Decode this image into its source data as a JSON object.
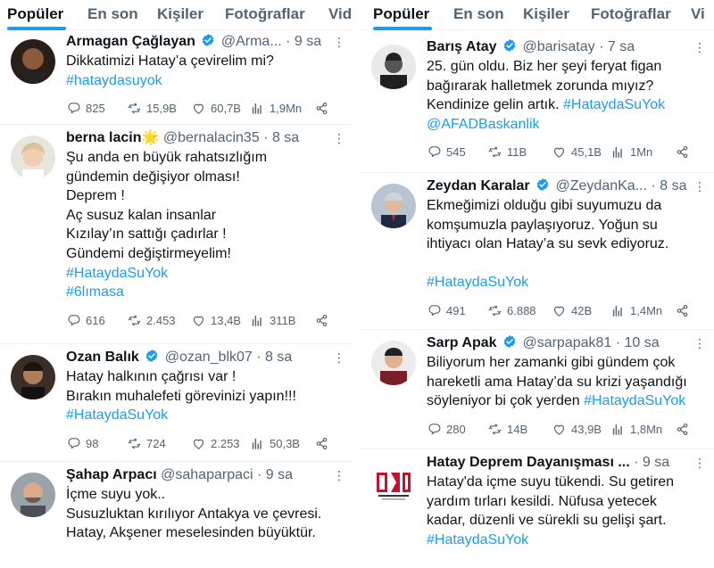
{
  "left": {
    "tabs": [
      "Popüler",
      "En son",
      "Kişiler",
      "Fotoğraflar",
      "Vid"
    ],
    "tweets": [
      {
        "name": "Armagan Çağlayan",
        "handle": "@Arma...",
        "time": "9 sa",
        "lines": [
          {
            "text": "Dikkatimizi Hatay’a çevirelim mi?",
            "tag": false
          },
          {
            "text": "#hataydasuyok",
            "tag": true
          }
        ],
        "replies": "825",
        "retweets": "15,9B",
        "likes": "60,7B",
        "views": "1,9Mn"
      },
      {
        "name": "berna lacin",
        "emoji": "🌟",
        "handle": "@bernalacin35",
        "time": "8 sa",
        "lines": [
          {
            "text": "Şu anda en büyük rahatsızlığım",
            "tag": false
          },
          {
            "text": "gündemin değişiyor olması!",
            "tag": false
          },
          {
            "text": "Deprem !",
            "tag": false
          },
          {
            "text": "Aç susuz kalan insanlar",
            "tag": false
          },
          {
            "text": "Kızılay’ın sattığı çadırlar !",
            "tag": false
          },
          {
            "text": "Gündemi değiştirmeyelim!",
            "tag": false
          },
          {
            "text": "#HataydaSuYok",
            "tag": true
          },
          {
            "text": "#6lımasa",
            "tag": true
          }
        ],
        "replies": "616",
        "retweets": "2.453",
        "likes": "13,4B",
        "views": "311B"
      },
      {
        "name": "Ozan Balık",
        "handle": "@ozan_blk07",
        "time": "8 sa",
        "lines": [
          {
            "text": "Hatay halkının çağrısı var !",
            "tag": false
          },
          {
            "text": "Bırakın muhalefeti görevinizi yapın!!!",
            "tag": false
          },
          {
            "text": "#HataydaSuYok",
            "tag": true
          }
        ],
        "replies": "98",
        "retweets": "724",
        "likes": "2.253",
        "views": "50,3B"
      },
      {
        "name": "Şahap Arpacı",
        "handle": "@sahaparpaci",
        "time": "9 sa",
        "lines": [
          {
            "text": "İçme suyu yok..",
            "tag": false
          },
          {
            "text": "Susuzluktan kırılıyor Antakya ve çevresi.",
            "tag": false
          },
          {
            "text": "Hatay, Akşener meselesinden büyüktür.",
            "tag": false
          }
        ]
      }
    ]
  },
  "right": {
    "tabs": [
      "Popüler",
      "En son",
      "Kişiler",
      "Fotoğraflar",
      "Vi"
    ],
    "tweets": [
      {
        "name": "Barış Atay",
        "handle": "@barisatay",
        "time": "7 sa",
        "lines": [
          {
            "text": "25. gün oldu. Biz her şeyi feryat figan",
            "tag": false
          },
          {
            "text": "bağırarak halletmek zorunda mıyız?",
            "tag": false
          },
          {
            "parts": [
              {
                "text": "Kendinize gelin artık. ",
                "tag": false
              },
              {
                "text": "#HataydaSuYok",
                "tag": true
              }
            ]
          },
          {
            "text": "@AFADBaskanlik",
            "tag": true
          }
        ],
        "replies": "545",
        "retweets": "11B",
        "likes": "45,1B",
        "views": "1Mn"
      },
      {
        "name": "Zeydan Karalar",
        "handle": "@ZeydanKa...",
        "time": "8 sa",
        "lines": [
          {
            "text": "Ekmeğimizi olduğu gibi suyumuzu da",
            "tag": false
          },
          {
            "text": "komşumuzla paylaşıyoruz. Yoğun su",
            "tag": false
          },
          {
            "text": "ihtiyacı olan Hatay’a su sevk ediyoruz.",
            "tag": false
          },
          {
            "text": "",
            "tag": false
          },
          {
            "text": "#HataydaSuYok",
            "tag": true
          }
        ],
        "replies": "491",
        "retweets": "6.888",
        "likes": "42B",
        "views": "1,4Mn"
      },
      {
        "name": "Sarp Apak",
        "handle": "@sarpapak81",
        "time": "10 sa",
        "lines": [
          {
            "text": "Biliyorum her zamanki gibi gündem çok",
            "tag": false
          },
          {
            "text": "hareketli ama Hatay’da su krizi yaşandığı",
            "tag": false
          },
          {
            "parts": [
              {
                "text": "söyleniyor bi çok yerden ",
                "tag": false
              },
              {
                "text": "#HataydaSuYok",
                "tag": true
              }
            ]
          }
        ],
        "replies": "280",
        "retweets": "14B",
        "likes": "43,9B",
        "views": "1,8Mn"
      },
      {
        "name": "Hatay Deprem Dayanışması ...",
        "handle": "",
        "time": "9 sa",
        "lines": [
          {
            "text": "Hatay'da içme suyu tükendi. Su getiren",
            "tag": false
          },
          {
            "text": "yardım tırları kesildi. Nüfusa yetecek",
            "tag": false
          },
          {
            "text": "kadar, düzenli ve sürekli su gelişi şart.",
            "tag": false
          },
          {
            "text": "#HataydaSuYok",
            "tag": true
          }
        ]
      }
    ]
  },
  "colors": {
    "accent": "#1d9bf0",
    "muted": "#536471",
    "text": "#0f1419",
    "divider": "#eff3f4",
    "logo_red": "#c8102e"
  },
  "icons": [
    "reply-icon",
    "retweet-icon",
    "like-icon",
    "views-icon",
    "share-icon",
    "verified-badge-icon",
    "more-icon"
  ]
}
